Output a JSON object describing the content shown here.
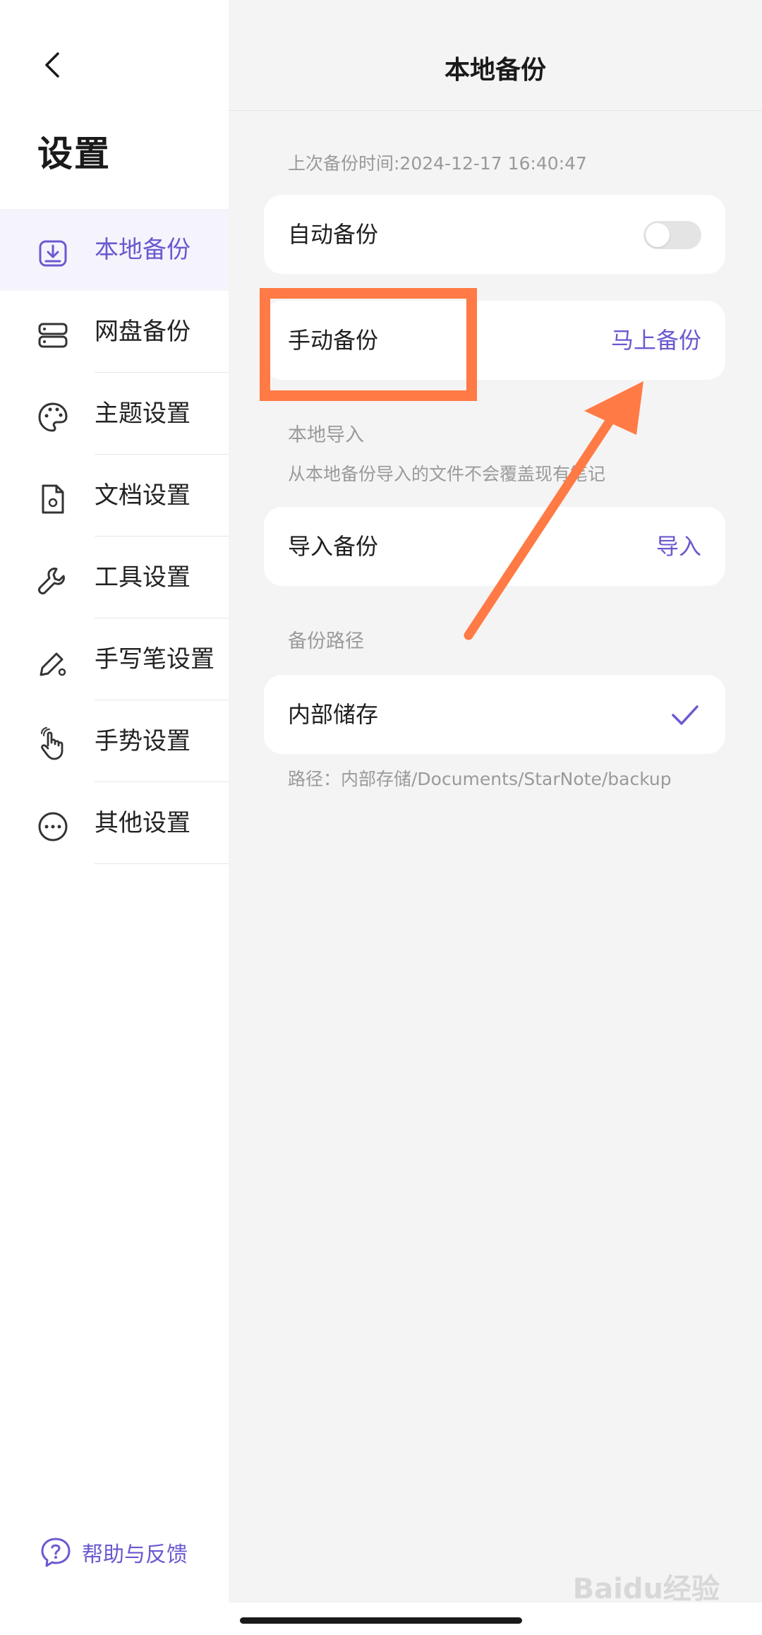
{
  "sidebar": {
    "title": "设置",
    "items": [
      {
        "label": "本地备份",
        "icon": "local-backup-icon",
        "active": true
      },
      {
        "label": "网盘备份",
        "icon": "cloud-storage-icon",
        "active": false
      },
      {
        "label": "主题设置",
        "icon": "palette-icon",
        "active": false
      },
      {
        "label": "文档设置",
        "icon": "document-settings-icon",
        "active": false
      },
      {
        "label": "工具设置",
        "icon": "wrench-icon",
        "active": false
      },
      {
        "label": "手写笔设置",
        "icon": "pen-settings-icon",
        "active": false
      },
      {
        "label": "手势设置",
        "icon": "gesture-hand-icon",
        "active": false
      },
      {
        "label": "其他设置",
        "icon": "more-dots-icon",
        "active": false
      }
    ],
    "help_label": "帮助与反馈"
  },
  "main": {
    "title": "本地备份",
    "last_backup": "上次备份时间:2024-12-17 16:40:47",
    "auto_backup": {
      "label": "自动备份",
      "enabled": false
    },
    "manual_backup": {
      "label": "手动备份",
      "action": "马上备份"
    },
    "local_import": {
      "section": "本地导入",
      "note": "从本地备份导入的文件不会覆盖现有笔记",
      "label": "导入备份",
      "action": "导入"
    },
    "backup_path": {
      "section": "备份路径",
      "option": "内部储存",
      "selected": true,
      "path": "路径：内部存储/Documents/StarNote/backup"
    }
  },
  "watermark": "Baidu经验",
  "colors": {
    "accent": "#6a5ad0",
    "annotation": "#ff7a45",
    "background": "#f4f4f4"
  }
}
